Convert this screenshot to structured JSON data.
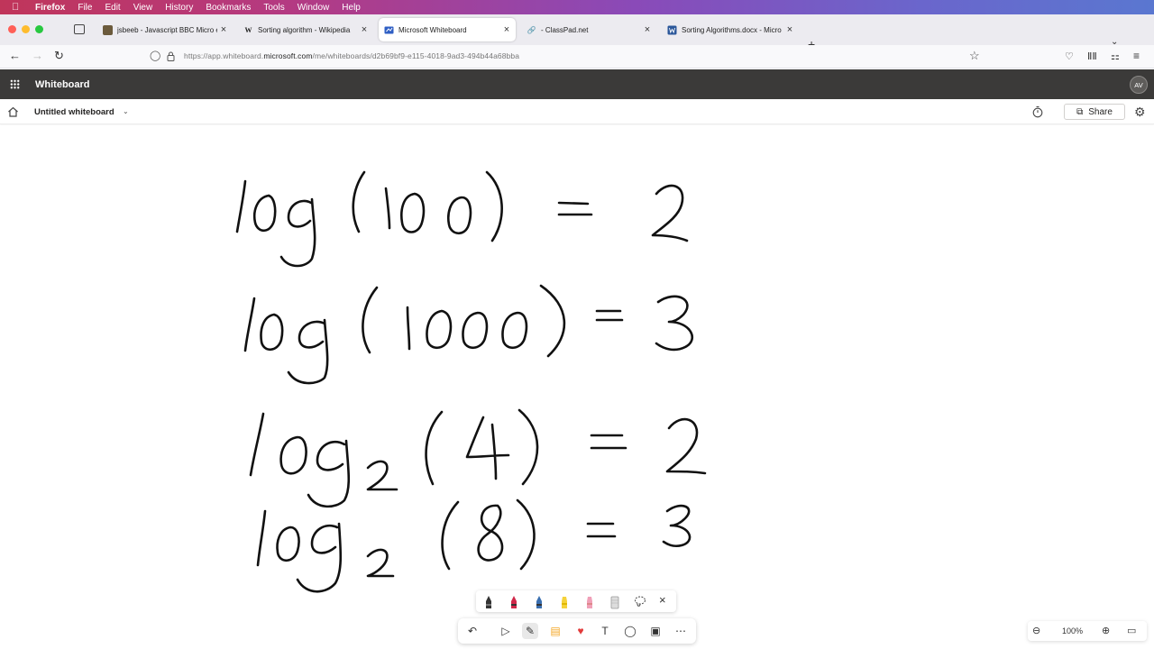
{
  "menubar": {
    "app": "Firefox",
    "items": [
      "File",
      "Edit",
      "View",
      "History",
      "Bookmarks",
      "Tools",
      "Window",
      "Help"
    ]
  },
  "tabs": [
    {
      "title": "jsbeeb - Javascript BBC Micro e",
      "favicon": "jsbeeb-icon"
    },
    {
      "title": "Sorting algorithm - Wikipedia",
      "favicon": "W"
    },
    {
      "title": "Microsoft Whiteboard",
      "favicon": "whiteboard-icon",
      "active": true
    },
    {
      "title": "- ClassPad.net",
      "favicon": "link-icon"
    },
    {
      "title": "Sorting Algorithms.docx - Micro",
      "favicon": "word-icon"
    }
  ],
  "navbar": {
    "url_prefix": "https://app.whiteboard.",
    "url_host": "microsoft.com",
    "url_path": "/me/whiteboards/d2b69bf9-e115-4018-9ad3-494b44a68bba"
  },
  "appbar": {
    "app_name": "Whiteboard",
    "avatar_initials": "AV"
  },
  "docbar": {
    "title": "Untitled whiteboard",
    "share_label": "Share"
  },
  "zoom": {
    "level": "100%"
  },
  "colors": {
    "appbar_bg": "#3b3a39",
    "ink": "#111111",
    "active_tab_bg": "#ffffff"
  }
}
